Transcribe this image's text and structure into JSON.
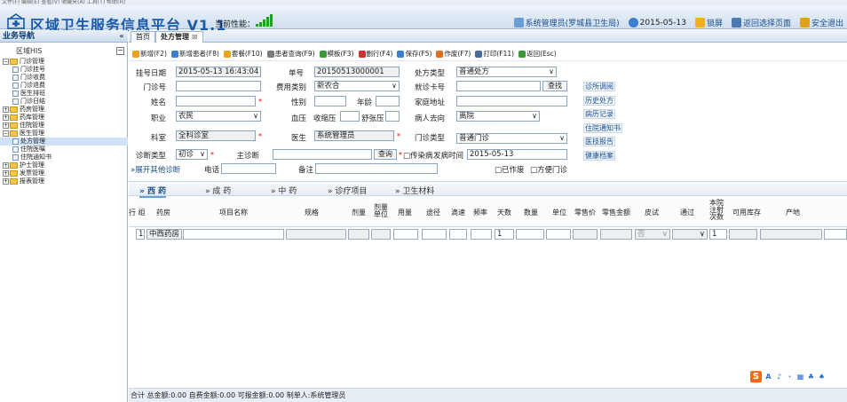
{
  "top_strip": "文件(F)  编辑(E)  查看(V)  收藏夹(A)  工具(T)  帮助(H)",
  "header": {
    "title": "区域卫生服务信息平台 V1.1",
    "perf_label": "当前性能：",
    "user": "系统管理员(罗城县卫生局)",
    "date": "2015-05-13",
    "lock": "锁屏",
    "back": "返回选择页面",
    "logout": "安全退出",
    "perf_color": "#1fa31f"
  },
  "sidebar": {
    "title": "业务导航",
    "collapse": "«",
    "subtitle": "区域HIS",
    "sub_toggle": "−",
    "tree": [
      {
        "label": "门诊管理",
        "level": 0,
        "type": "folder",
        "pm": "−"
      },
      {
        "label": "门诊挂号",
        "level": 1,
        "type": "doc"
      },
      {
        "label": "门诊收费",
        "level": 1,
        "type": "doc"
      },
      {
        "label": "门诊退费",
        "level": 1,
        "type": "doc"
      },
      {
        "label": "医生排班",
        "level": 1,
        "type": "doc"
      },
      {
        "label": "门诊日结",
        "level": 1,
        "type": "doc"
      },
      {
        "label": "药房管理",
        "level": 0,
        "type": "folder",
        "pm": "+"
      },
      {
        "label": "药库管理",
        "level": 0,
        "type": "folder",
        "pm": "+"
      },
      {
        "label": "住院管理",
        "level": 0,
        "type": "folder",
        "pm": "+"
      },
      {
        "label": "医生管理",
        "level": 0,
        "type": "folder",
        "pm": "−"
      },
      {
        "label": "处方管理",
        "level": 1,
        "type": "doc",
        "selected": true
      },
      {
        "label": "住院医嘱",
        "level": 1,
        "type": "doc"
      },
      {
        "label": "住院通知书",
        "level": 1,
        "type": "doc"
      },
      {
        "label": "护士管理",
        "level": 0,
        "type": "folder",
        "pm": "+"
      },
      {
        "label": "发票管理",
        "level": 0,
        "type": "folder",
        "pm": "+"
      },
      {
        "label": "报表管理",
        "level": 0,
        "type": "folder",
        "pm": "+"
      }
    ]
  },
  "tabs": [
    {
      "label": "首页"
    },
    {
      "label": "处方管理",
      "close": "⊠"
    }
  ],
  "toolbar": [
    {
      "label": "新增(F2)",
      "color": "#f0a020"
    },
    {
      "label": "新增患者(F8)",
      "color": "#3a7fd0"
    },
    {
      "label": "套餐(F10)",
      "color": "#f0a020"
    },
    {
      "label": "患者查询(F9)",
      "color": "#7a7a7a"
    },
    {
      "label": "模板(F3)",
      "color": "#3a9a3a"
    },
    {
      "label": "删行(F4)",
      "color": "#d03030"
    },
    {
      "label": "保存(F5)",
      "color": "#3a7fd0"
    },
    {
      "label": "作废(F7)",
      "color": "#e07020"
    },
    {
      "label": "打印(F11)",
      "color": "#4a6a9a"
    },
    {
      "label": "返回(Esc)",
      "color": "#3a9a3a"
    }
  ],
  "form": {
    "reg_date_label": "挂号日期",
    "reg_date": "2015-05-13 16:43:04",
    "no_label": "单号",
    "no": "20150513000001",
    "rx_type_label": "处方类型",
    "rx_type": "普通处方",
    "clinic_no_label": "门诊号",
    "clinic_no": "",
    "fee_type_label": "费用类别",
    "fee_type": "新农合",
    "card_label": "就诊卡号",
    "card": "",
    "search": "查找",
    "name_label": "姓名",
    "name": "",
    "sex_label": "性别",
    "sex": "",
    "age_label": "年龄",
    "age": "",
    "addr_label": "家庭地址",
    "addr": "",
    "job_label": "职业",
    "job": "农民",
    "bp_label": "血压",
    "sys_label": "收缩压",
    "dia_label": "舒张压",
    "dest_label": "病人去向",
    "dest": "离院",
    "dept_label": "科室",
    "dept": "全科诊室",
    "doctor_label": "医生",
    "doctor": "系统管理员",
    "clinic_type_label": "门诊类型",
    "clinic_type": "普通门诊",
    "diag_type_label": "诊断类型",
    "diag_type": "初诊",
    "main_diag_label": "主诊断",
    "main_diag": "",
    "query": "查询",
    "infect_label": "传染病",
    "onset_label": "发病时间",
    "onset": "2015-05-13",
    "void_label": "已作废",
    "easy_label": "方便门诊",
    "expand_label": "展开其他诊断",
    "phone_label": "电话",
    "phone": "",
    "remark_label": "备注",
    "remark": "",
    "right_buttons": [
      "诊所调阅",
      "历史处方",
      "病历记录",
      "住院通知书",
      "医技报告",
      "健康档案"
    ]
  },
  "content_tabs": [
    {
      "label": "» 西 药"
    },
    {
      "label": "» 成 药"
    },
    {
      "label": "» 中 药"
    },
    {
      "label": "» 诊疗项目"
    },
    {
      "label": "» 卫生材料"
    }
  ],
  "grid": {
    "headers": [
      "行 组",
      "药房",
      "项目名称",
      "规格",
      "剂量",
      "剂量单位",
      "用量",
      "途径",
      "滴速",
      "频率",
      "天数",
      "数量",
      "单位",
      "零售价",
      "零售金额",
      "皮试",
      "通过",
      "本院注射次数",
      "可用库存",
      "产地"
    ],
    "row": {
      "line": "1",
      "pharmacy": "中西药房",
      "days": "1",
      "skin": "否",
      "inject": "1"
    }
  },
  "status": "合计  总金额:0.00  自费金额:0.00   可报金额:0.00  制单人:系统管理员",
  "ime": [
    "S",
    "A",
    "♪",
    "·",
    "▦",
    "♣",
    "♠"
  ]
}
